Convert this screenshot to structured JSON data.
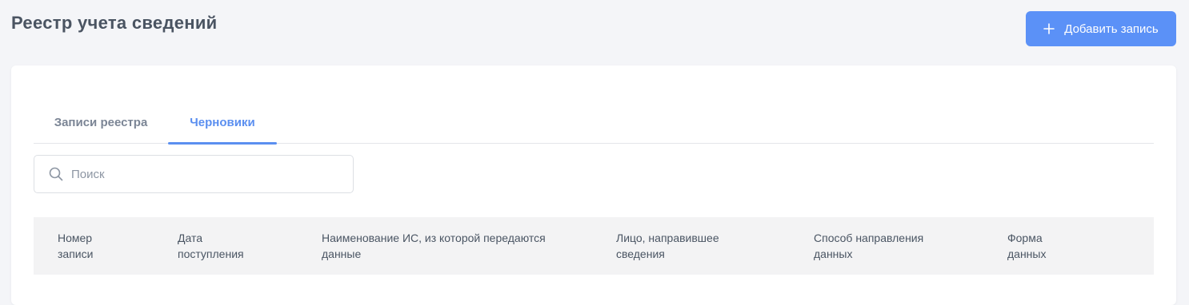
{
  "header": {
    "title": "Реестр учета сведений",
    "add_button_label": "Добавить запись",
    "add_button_icon": "plus-icon"
  },
  "tabs": [
    {
      "label": "Записи реестра",
      "active": false
    },
    {
      "label": "Черновики",
      "active": true
    }
  ],
  "search": {
    "placeholder": "Поиск",
    "value": "",
    "icon": "search-icon"
  },
  "table": {
    "columns": [
      {
        "line1": "Номер",
        "line2": "записи"
      },
      {
        "line1": "Дата",
        "line2": "поступления"
      },
      {
        "line1": "Наименование ИС, из которой передаются",
        "line2": "данные"
      },
      {
        "line1": "Лицо, направившее",
        "line2": "сведения"
      },
      {
        "line1": "Способ направления",
        "line2": "данных"
      },
      {
        "line1": "Форма",
        "line2": "данных"
      }
    ],
    "rows": []
  },
  "colors": {
    "accent": "#5b8ff0",
    "button": "#5b91f7",
    "background": "#f4f5f8",
    "table_header_bg": "#f3f3f4"
  }
}
